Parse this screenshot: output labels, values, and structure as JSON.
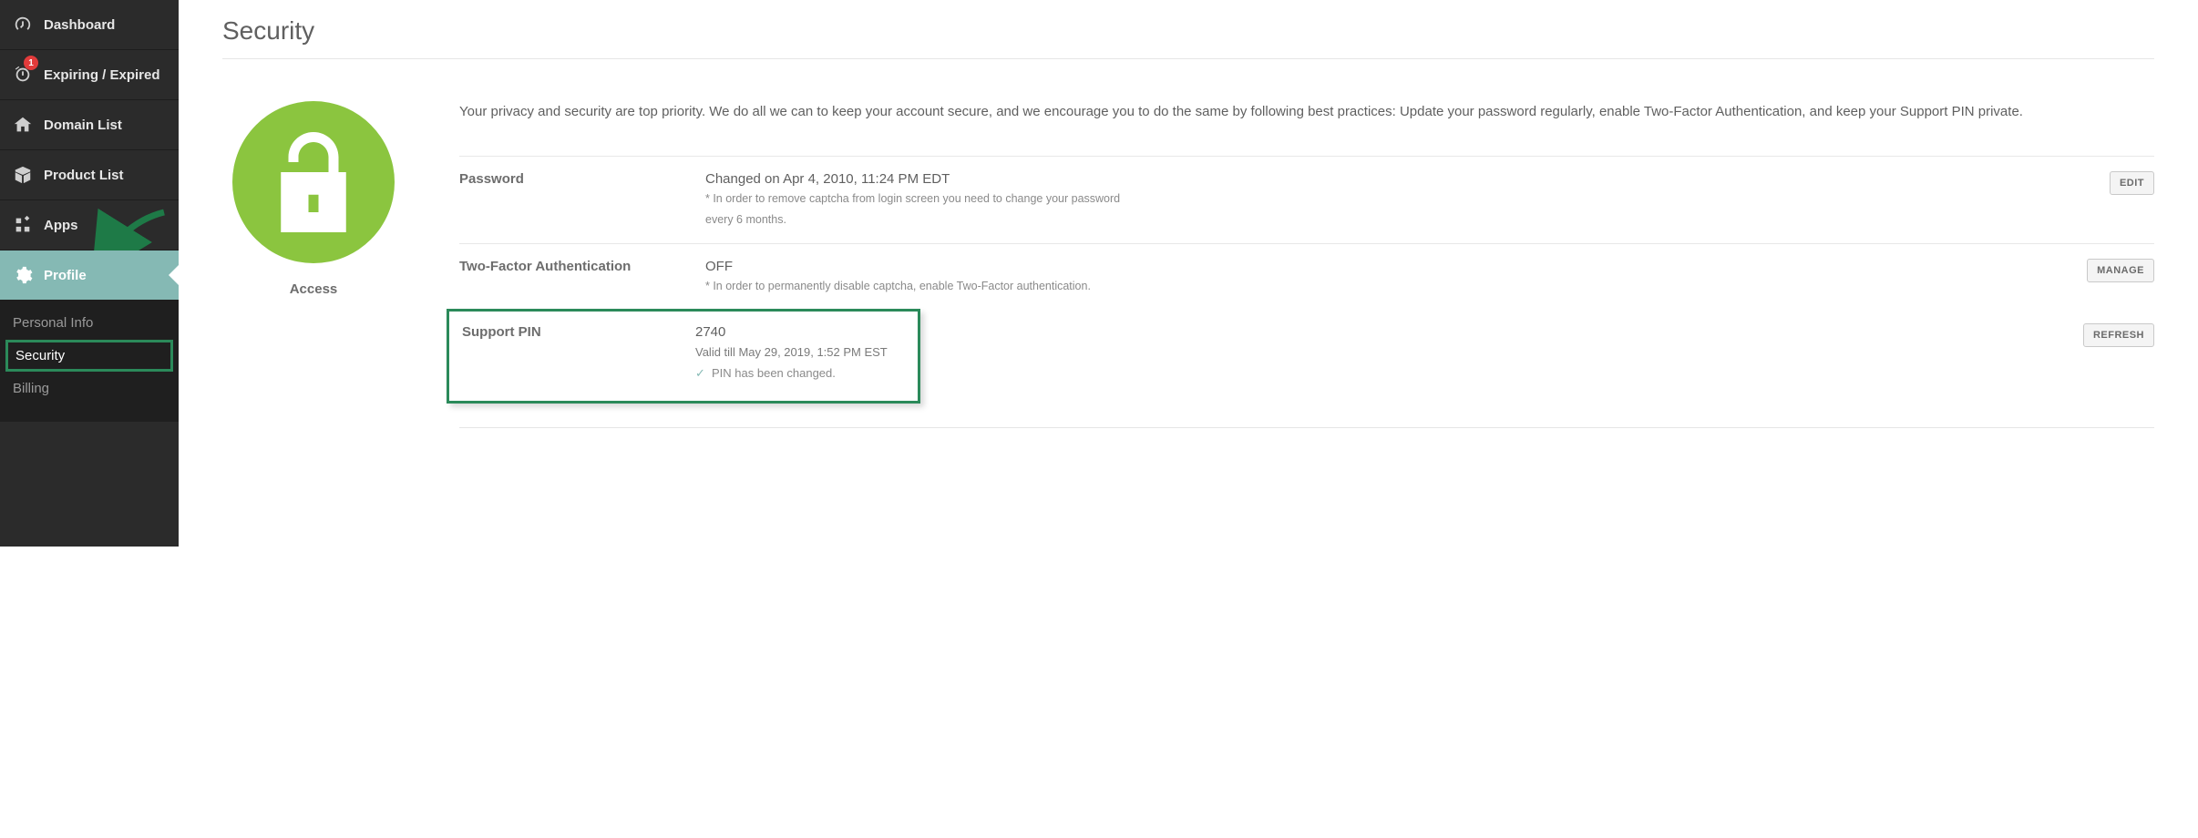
{
  "sidebar": {
    "items": [
      {
        "label": "Dashboard"
      },
      {
        "label": "Expiring / Expired",
        "badge": "1"
      },
      {
        "label": "Domain List"
      },
      {
        "label": "Product List"
      },
      {
        "label": "Apps"
      },
      {
        "label": "Profile"
      }
    ],
    "sub": [
      {
        "label": "Personal Info"
      },
      {
        "label": "Security"
      },
      {
        "label": "Billing"
      }
    ]
  },
  "page": {
    "title": "Security",
    "section_label": "Access",
    "intro": "Your privacy and security are top priority. We do all we can to keep your account secure, and we encourage you to do the same by following best practices: Update your password regularly, enable Two-Factor Authentication, and keep your Support PIN private."
  },
  "rows": {
    "password": {
      "label": "Password",
      "value": "Changed on Apr 4, 2010, 11:24 PM EDT",
      "note1": "* In order to remove captcha from login screen you need to change your password",
      "note2": "every 6 months.",
      "action": "EDIT"
    },
    "twofa": {
      "label": "Two-Factor Authentication",
      "value": "OFF",
      "note": "* In order to permanently disable captcha, enable Two-Factor authentication.",
      "action": "MANAGE"
    },
    "pin": {
      "label": "Support PIN",
      "value": "2740",
      "valid": "Valid till May 29, 2019, 1:52 PM EST",
      "changed": "PIN has been changed.",
      "action": "REFRESH"
    }
  }
}
